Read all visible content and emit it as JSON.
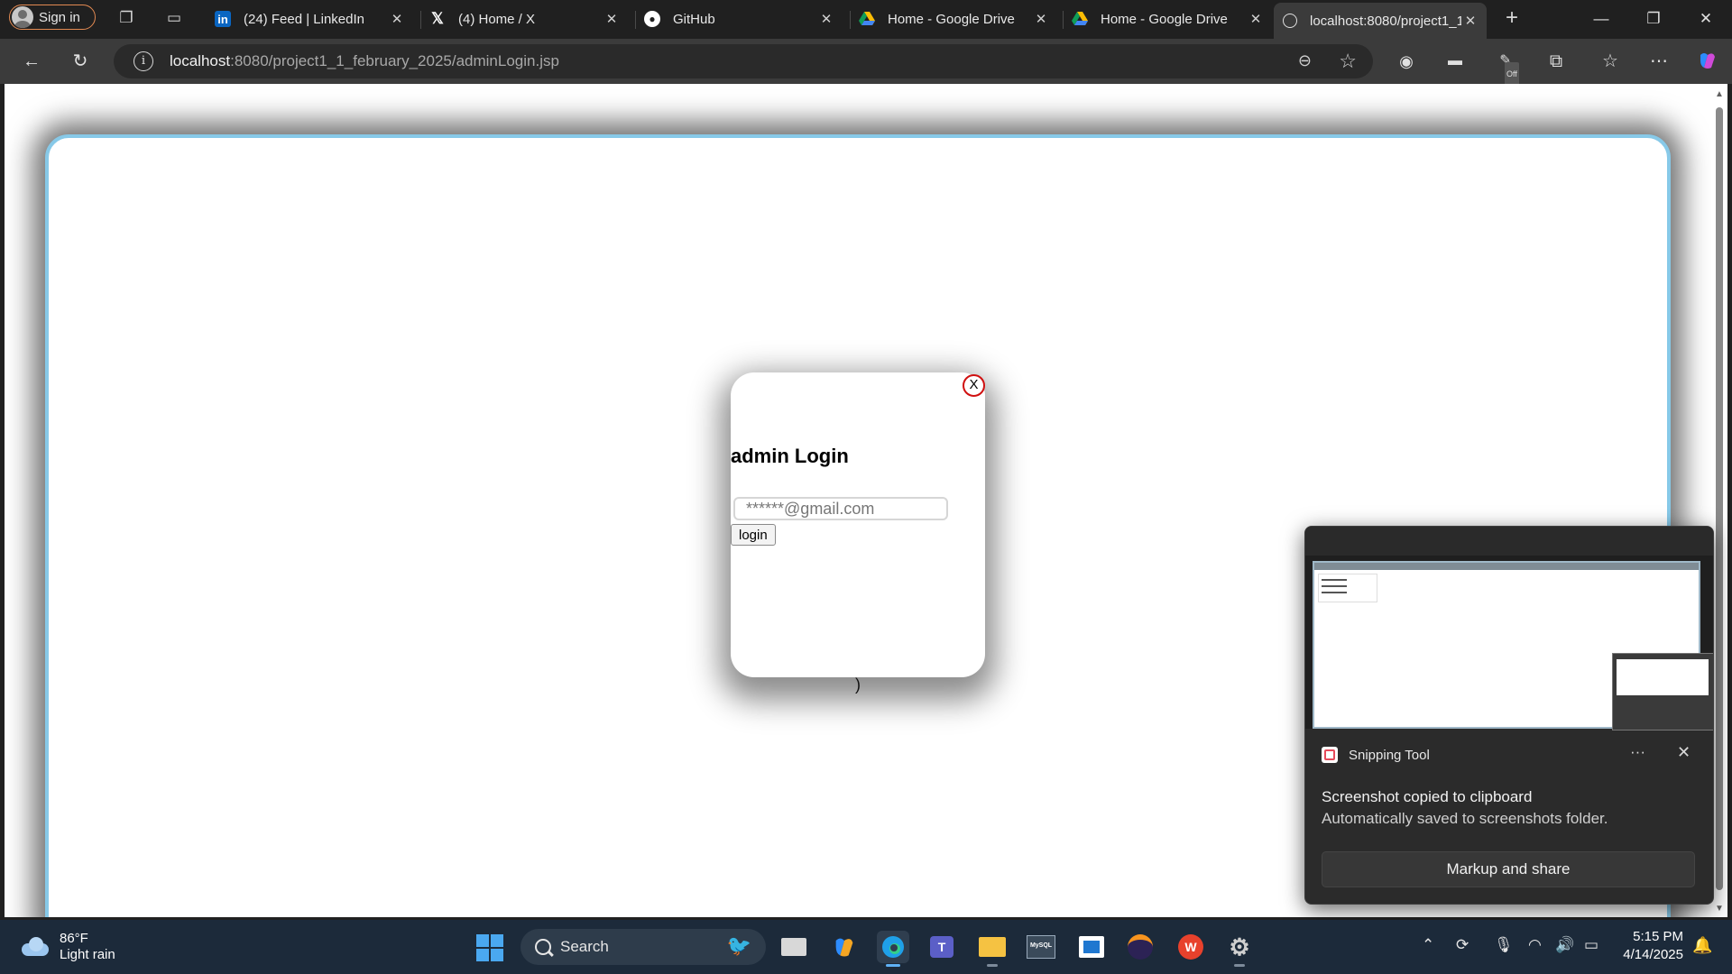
{
  "browser": {
    "profile_label": "Sign in",
    "tabs": [
      {
        "title": "(24) Feed | LinkedIn",
        "icon": "linkedin-icon"
      },
      {
        "title": "(4) Home / X",
        "icon": "x-icon"
      },
      {
        "title": "GitHub",
        "icon": "github-icon"
      },
      {
        "title": "Home - Google Drive",
        "icon": "google-drive-icon"
      },
      {
        "title": "Home - Google Drive",
        "icon": "google-drive-icon"
      },
      {
        "title": "localhost:8080/project1_1",
        "icon": "globe-icon",
        "active": true
      }
    ],
    "address": {
      "host": "localhost",
      "path": ":8080/project1_1_february_2025/adminLogin.jsp"
    },
    "extension_badge": "Off"
  },
  "page": {
    "modal": {
      "close_label": "X",
      "heading": "admin Login",
      "email_placeholder": "******@gmail.com",
      "login_label": "login"
    },
    "stray_text": ")"
  },
  "notification": {
    "app_name": "Snipping Tool",
    "title": "Screenshot copied to clipboard",
    "body": "Automatically saved to screenshots folder.",
    "action_label": "Markup and share",
    "more_label": "···"
  },
  "taskbar": {
    "weather": {
      "temp": "86°F",
      "condition": "Light rain"
    },
    "search_label": "Search",
    "time": "5:15 PM",
    "date": "4/14/2025",
    "apps": [
      "task-view",
      "copilot",
      "edge",
      "teams",
      "file-explorer",
      "mysql-workbench",
      "microsoft-store",
      "eclipse",
      "wps-office",
      "settings"
    ]
  },
  "colors": {
    "frame_border": "#87c9e8",
    "close_ring": "#d01010",
    "taskbar_bg": "#1c2a3a",
    "accent": "#5fb1f5"
  }
}
